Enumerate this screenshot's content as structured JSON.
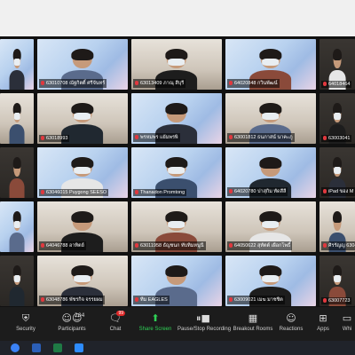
{
  "gallery": {
    "tiles": [
      {
        "name": "",
        "scene": "slide"
      },
      {
        "name": "63010708 ณัฐกิตติ์ ศรีจันทร์",
        "scene": "slide"
      },
      {
        "name": "63013409 ภาณุ สีบุรี",
        "scene": "room"
      },
      {
        "name": "64020848 กวินพัฒน์",
        "scene": "slide"
      },
      {
        "name": "64018464",
        "scene": "dark"
      },
      {
        "name": "",
        "scene": "room"
      },
      {
        "name": "63018993",
        "scene": "room"
      },
      {
        "name": "พรหมพร แย้มพรพิ",
        "scene": "slide"
      },
      {
        "name": "63001812 ธนภาสน์ นาคะภู",
        "scene": "room"
      },
      {
        "name": "63003041",
        "scene": "dark"
      },
      {
        "name": "",
        "scene": "dark"
      },
      {
        "name": "63046015 Puygong SEESO",
        "scene": "slide"
      },
      {
        "name": "Thanadon Promtong",
        "scene": "slide"
      },
      {
        "name": "64020780 ปาสุกิม ทัดสีลี",
        "scene": "slide"
      },
      {
        "name": "iPad ของ M",
        "scene": "dark"
      },
      {
        "name": "",
        "scene": "slide"
      },
      {
        "name": "64046788 อาทิตย์",
        "scene": "room"
      },
      {
        "name": "63011958 ธัญชนก ทับทิมหนูนี",
        "scene": "room"
      },
      {
        "name": "64050622 สุทัตต์ เผือกโพธิ์",
        "scene": "room"
      },
      {
        "name": "ศิรรัญญ 6304",
        "scene": "room"
      },
      {
        "name": "",
        "scene": "dark"
      },
      {
        "name": "63048786 พัชรกิจ จรรยผม",
        "scene": "room"
      },
      {
        "name": "ทีม EAGLES",
        "scene": "slide"
      },
      {
        "name": "63009021 เมฆ มาชชิต",
        "scene": "slide"
      },
      {
        "name": "63007723",
        "scene": "dark"
      }
    ]
  },
  "toolbar": {
    "security": "Security",
    "participants": "Participants",
    "participants_count": "204",
    "chat": "Chat",
    "chat_badge": "99",
    "share": "Share Screen",
    "record": "Pause/Stop Recording",
    "breakout": "Breakout Rooms",
    "reactions": "Reactions",
    "apps": "Apps",
    "whiteboard": "Whi"
  },
  "colors": {
    "share_green": "#2fd056",
    "mute_red": "#e0383e",
    "toolbar_bg": "#1c1c1c"
  }
}
